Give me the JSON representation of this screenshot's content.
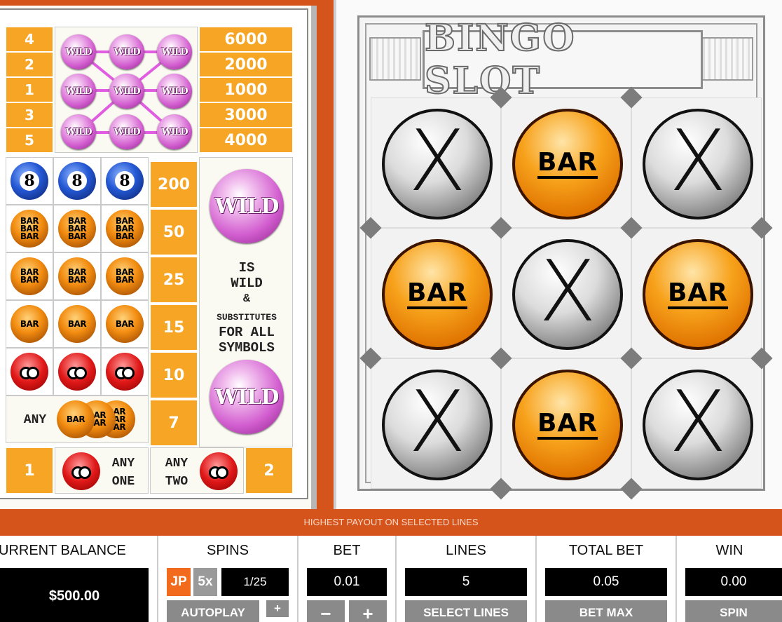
{
  "paytable": {
    "lines": [
      {
        "line": "4",
        "payout": "6000"
      },
      {
        "line": "2",
        "payout": "2000"
      },
      {
        "line": "1",
        "payout": "1000"
      },
      {
        "line": "3",
        "payout": "3000"
      },
      {
        "line": "5",
        "payout": "4000"
      }
    ],
    "wild_label": "WILD",
    "symbol_pays": [
      "200",
      "50",
      "25",
      "15",
      "10",
      "7"
    ],
    "eight_label": "8",
    "bar_label": "BAR",
    "wild_text": [
      "IS",
      "WILD",
      "&",
      "SUBSTITUTES",
      "FOR ALL",
      "SYMBOLS"
    ],
    "any_label": "ANY",
    "any_one": {
      "pay": "1",
      "text1": "ANY",
      "text2": "ONE"
    },
    "any_two": {
      "pay": "2",
      "text1": "ANY",
      "text2": "TWO"
    }
  },
  "game": {
    "title": "BINGO SLOT",
    "grid": [
      [
        "X",
        "BAR",
        "X"
      ],
      [
        "BAR",
        "X",
        "BAR"
      ],
      [
        "X",
        "BAR",
        "X"
      ]
    ]
  },
  "notice": "HIGHEST PAYOUT ON SELECTED LINES",
  "controls": {
    "balance": {
      "title": "URRENT BALANCE",
      "value": "$500.00"
    },
    "spins": {
      "title": "SPINS",
      "jp": "JP",
      "multiplier": "5x",
      "count": "1/25",
      "autoplay": "AUTOPLAY",
      "plus": "+"
    },
    "bet": {
      "title": "BET",
      "value": "0.01",
      "minus": "−",
      "plus": "+"
    },
    "lines": {
      "title": "LINES",
      "value": "5",
      "button": "SELECT LINES"
    },
    "total_bet": {
      "title": "TOTAL BET",
      "value": "0.05",
      "button": "BET MAX"
    },
    "win": {
      "title": "WIN",
      "value": "0.00",
      "button": "SPIN"
    }
  },
  "colors": {
    "accent_orange": "#f6a524",
    "background_red": "#d4541c",
    "wild_pink": "#d35fd0"
  }
}
